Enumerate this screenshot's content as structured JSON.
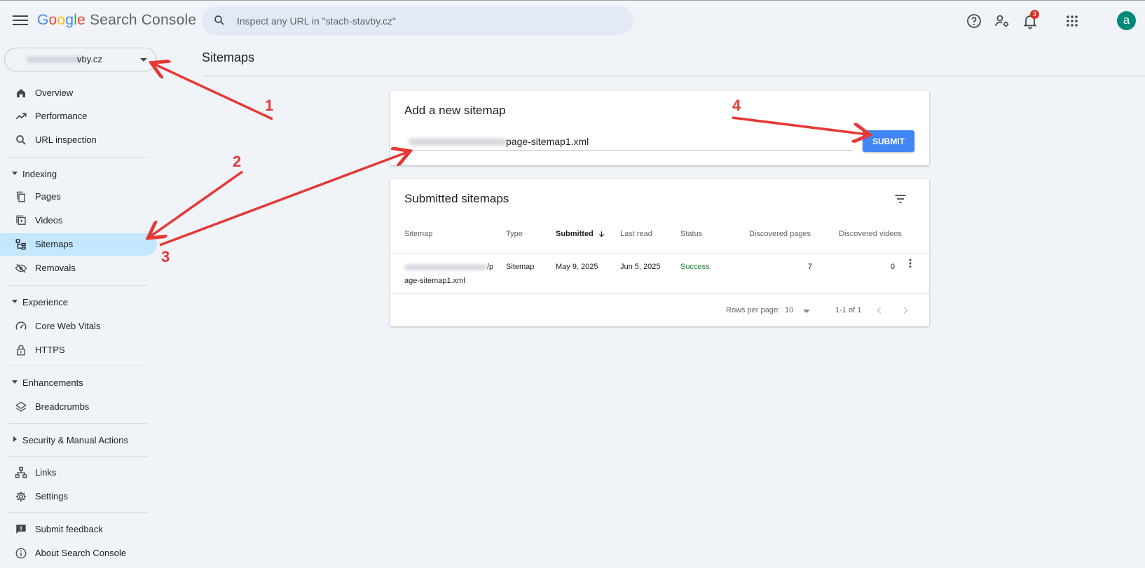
{
  "header": {
    "logo_google_letters": [
      "G",
      "o",
      "o",
      "g",
      "l",
      "e"
    ],
    "logo_product": "Search Console",
    "search_placeholder": "Inspect any URL in \"stach-stavby.cz\"",
    "notification_count": "3",
    "avatar_letter": "a",
    "icons": [
      "menu-icon",
      "search-icon",
      "help-icon",
      "manage-users-icon",
      "notifications-icon",
      "apps-grid-icon"
    ]
  },
  "property_selector": {
    "value": "vby.cz"
  },
  "sidebar": {
    "items": [
      {
        "label": "Overview",
        "icon": "home-icon"
      },
      {
        "label": "Performance",
        "icon": "trending-up-icon"
      },
      {
        "label": "URL inspection",
        "icon": "search-icon"
      }
    ],
    "sections": [
      {
        "label": "Indexing",
        "expanded": true,
        "items": [
          {
            "label": "Pages",
            "icon": "pages-icon"
          },
          {
            "label": "Videos",
            "icon": "videos-icon"
          },
          {
            "label": "Sitemaps",
            "icon": "sitemap-icon",
            "active": true
          },
          {
            "label": "Removals",
            "icon": "visibility-off-icon"
          }
        ]
      },
      {
        "label": "Experience",
        "expanded": true,
        "items": [
          {
            "label": "Core Web Vitals",
            "icon": "speed-gauge-icon"
          },
          {
            "label": "HTTPS",
            "icon": "lock-icon"
          }
        ]
      },
      {
        "label": "Enhancements",
        "expanded": true,
        "items": [
          {
            "label": "Breadcrumbs",
            "icon": "layers-icon"
          }
        ]
      },
      {
        "label": "Security & Manual Actions",
        "expanded": false,
        "items": []
      }
    ],
    "bottom_items": [
      {
        "label": "Links",
        "icon": "links-icon"
      },
      {
        "label": "Settings",
        "icon": "settings-icon"
      },
      {
        "label": "Submit feedback",
        "icon": "feedback-icon"
      },
      {
        "label": "About Search Console",
        "icon": "info-icon"
      }
    ]
  },
  "main": {
    "page_title": "Sitemaps",
    "add_card": {
      "heading": "Add a new sitemap",
      "input_value": "page-sitemap1.xml",
      "submit_label": "SUBMIT"
    },
    "submitted_card": {
      "heading": "Submitted sitemaps",
      "columns": [
        "Sitemap",
        "Type",
        "Submitted",
        "Last read",
        "Status",
        "Discovered pages",
        "Discovered videos"
      ],
      "sorted_column": "Submitted",
      "rows": [
        {
          "sitemap_line1": "/p",
          "sitemap_line2": "age-sitemap1.xml",
          "type": "Sitemap",
          "submitted": "May 9, 2025",
          "last_read": "Jun 5, 2025",
          "status": "Success",
          "discovered_pages": "7",
          "discovered_videos": "0"
        }
      ],
      "footer": {
        "rows_per_page_label": "Rows per page:",
        "rows_per_page_value": "10",
        "range": "1-1 of 1"
      }
    }
  },
  "annotations": [
    "1",
    "2",
    "3",
    "4"
  ],
  "colors": {
    "background": "#f0f4f9",
    "active_nav": "#c2e7ff",
    "submit_button": "#4285f4",
    "success": "#188038",
    "annotation_red": "#e53935",
    "avatar": "#00897b"
  }
}
